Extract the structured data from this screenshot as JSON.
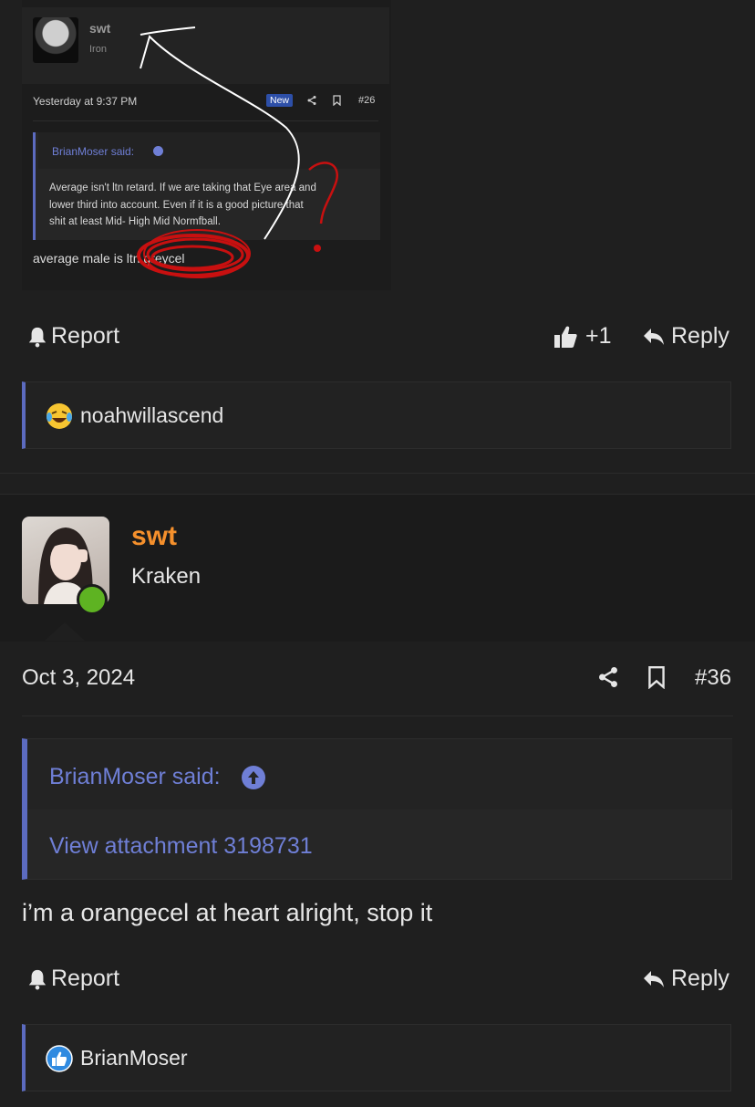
{
  "colors": {
    "background": "#1f1f1f",
    "accent_quote": "#5c6bc0",
    "username_orange": "#f5902c",
    "online_green": "#5eb322",
    "text": "#e6e6e6",
    "annotation_red": "#c81010"
  },
  "attachment_screenshot": {
    "username": "swt",
    "rank": "Iron",
    "date": "Yesterday at 9:37 PM",
    "new_badge": "New",
    "post_number": "#26",
    "quote_author": "BrianMoser said:",
    "quote_lines": [
      "Average isn't ltn retard. If we are taking that Eye area and",
      "lower third into account. Even if it is a good picture that",
      "shit at least Mid- High Mid Normfball."
    ],
    "reply_text": "average male is ltn greycel",
    "icons": [
      "share-icon",
      "bookmark-icon",
      "arrow-up-circle-icon"
    ]
  },
  "prev_post": {
    "report_label": "Report",
    "like_count": "+1",
    "reply_label": "Reply",
    "reactions": [
      {
        "icon": "laughing-crying-emoji-icon",
        "user": "noahwillascend"
      }
    ]
  },
  "post": {
    "username": "swt",
    "rank": "Kraken",
    "date": "Oct 3, 2024",
    "post_number": "#36",
    "quote": {
      "author": "BrianMoser said:",
      "attachment_link": "View attachment 3198731"
    },
    "message": "i’m a orangecel at heart alright, stop it",
    "report_label": "Report",
    "reply_label": "Reply",
    "reactions": [
      {
        "icon": "like-thumb-icon",
        "user": "BrianMoser"
      }
    ]
  }
}
